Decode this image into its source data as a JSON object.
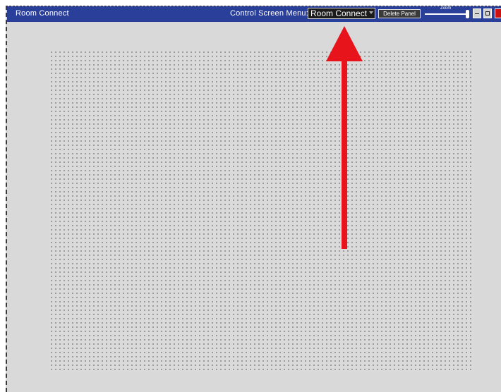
{
  "window": {
    "title": "Room Connect"
  },
  "header": {
    "menu_label": "Control Screen Menu:",
    "menu_selected": "Room Connect",
    "delete_button": "Delete Panel",
    "zoom_label": "Zoom"
  },
  "colors": {
    "titlebar": "#2a3f9a",
    "canvas_background": "#d9d9d9",
    "grid_dot": "#8a8a8a",
    "annotation_arrow": "#e8141b",
    "close_button": "#cc1111"
  },
  "icons": {
    "minimize": "minimize-icon",
    "maximize": "maximize-icon",
    "close": "close-icon",
    "dropdown": "chevron-down-icon",
    "annotation": "arrow-up-icon"
  }
}
